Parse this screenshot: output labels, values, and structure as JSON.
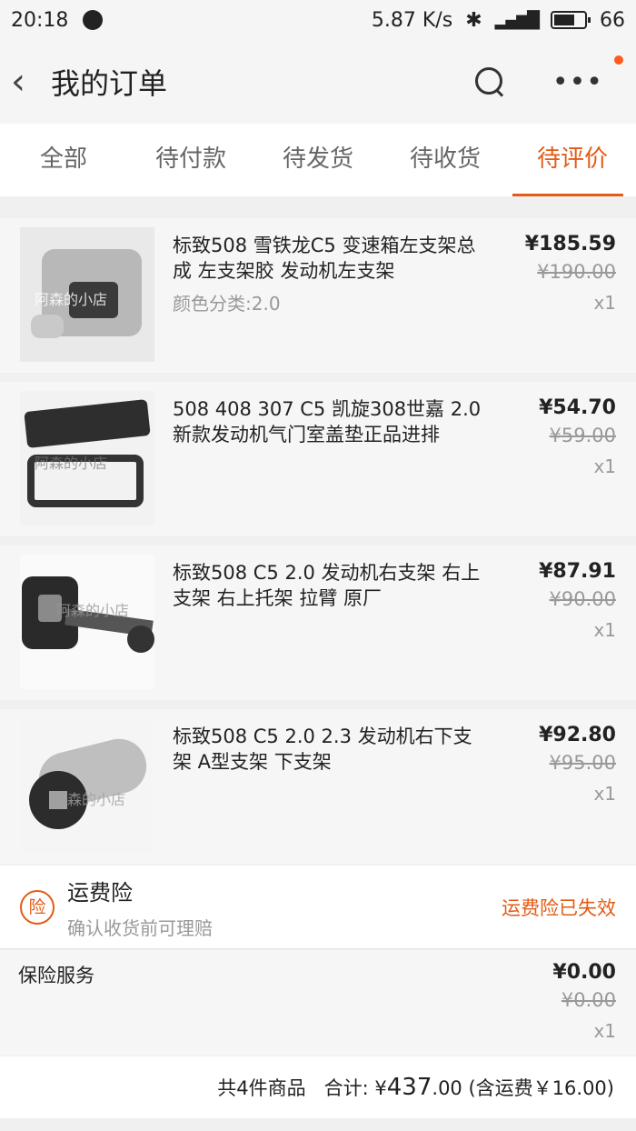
{
  "status_bar": {
    "time": "20:18",
    "speed": "5.87 K/s",
    "battery": "66"
  },
  "nav": {
    "title": "我的订单"
  },
  "tabs": [
    {
      "label": "全部"
    },
    {
      "label": "待付款"
    },
    {
      "label": "待发货"
    },
    {
      "label": "待收货"
    },
    {
      "label": "待评价",
      "active": true
    }
  ],
  "items": [
    {
      "name": "标致508 雪铁龙C5 变速箱左支架总成 左支架胶 发动机左支架",
      "sku": "颜色分类:2.0",
      "price": "¥185.59",
      "orig_price": "¥190.00",
      "qty": "x1",
      "watermark": "阿森的小店"
    },
    {
      "name": "508 408 307 C5 凯旋308世嘉 2.0新款发动机气门室盖垫正品进排",
      "sku": "",
      "price": "¥54.70",
      "orig_price": "¥59.00",
      "qty": "x1",
      "watermark": "阿森的小店"
    },
    {
      "name": "标致508 C5 2.0  发动机右支架 右上支架 右上托架 拉臂 原厂",
      "sku": "",
      "price": "¥87.91",
      "orig_price": "¥90.00",
      "qty": "x1",
      "watermark": "阿森的小店"
    },
    {
      "name": "标致508 C5 2.0 2.3 发动机右下支架 A型支架 下支架",
      "sku": "",
      "price": "¥92.80",
      "orig_price": "¥95.00",
      "qty": "x1",
      "watermark": "阿森的小店"
    }
  ],
  "freight_insurance": {
    "badge": "险",
    "title": "运费险",
    "subtitle": "确认收货前可理赔",
    "status": "运费险已失效"
  },
  "insurance_service": {
    "title": "保险服务",
    "price": "¥0.00",
    "orig_price": "¥0.00",
    "qty": "x1"
  },
  "summary": {
    "count_text": "共4件商品",
    "total_label": "合计: ¥",
    "total_int": "437",
    "total_dec": ".00",
    "shipping_note": "(含运费￥16.00)"
  },
  "colors": {
    "accent": "#e45a16"
  }
}
